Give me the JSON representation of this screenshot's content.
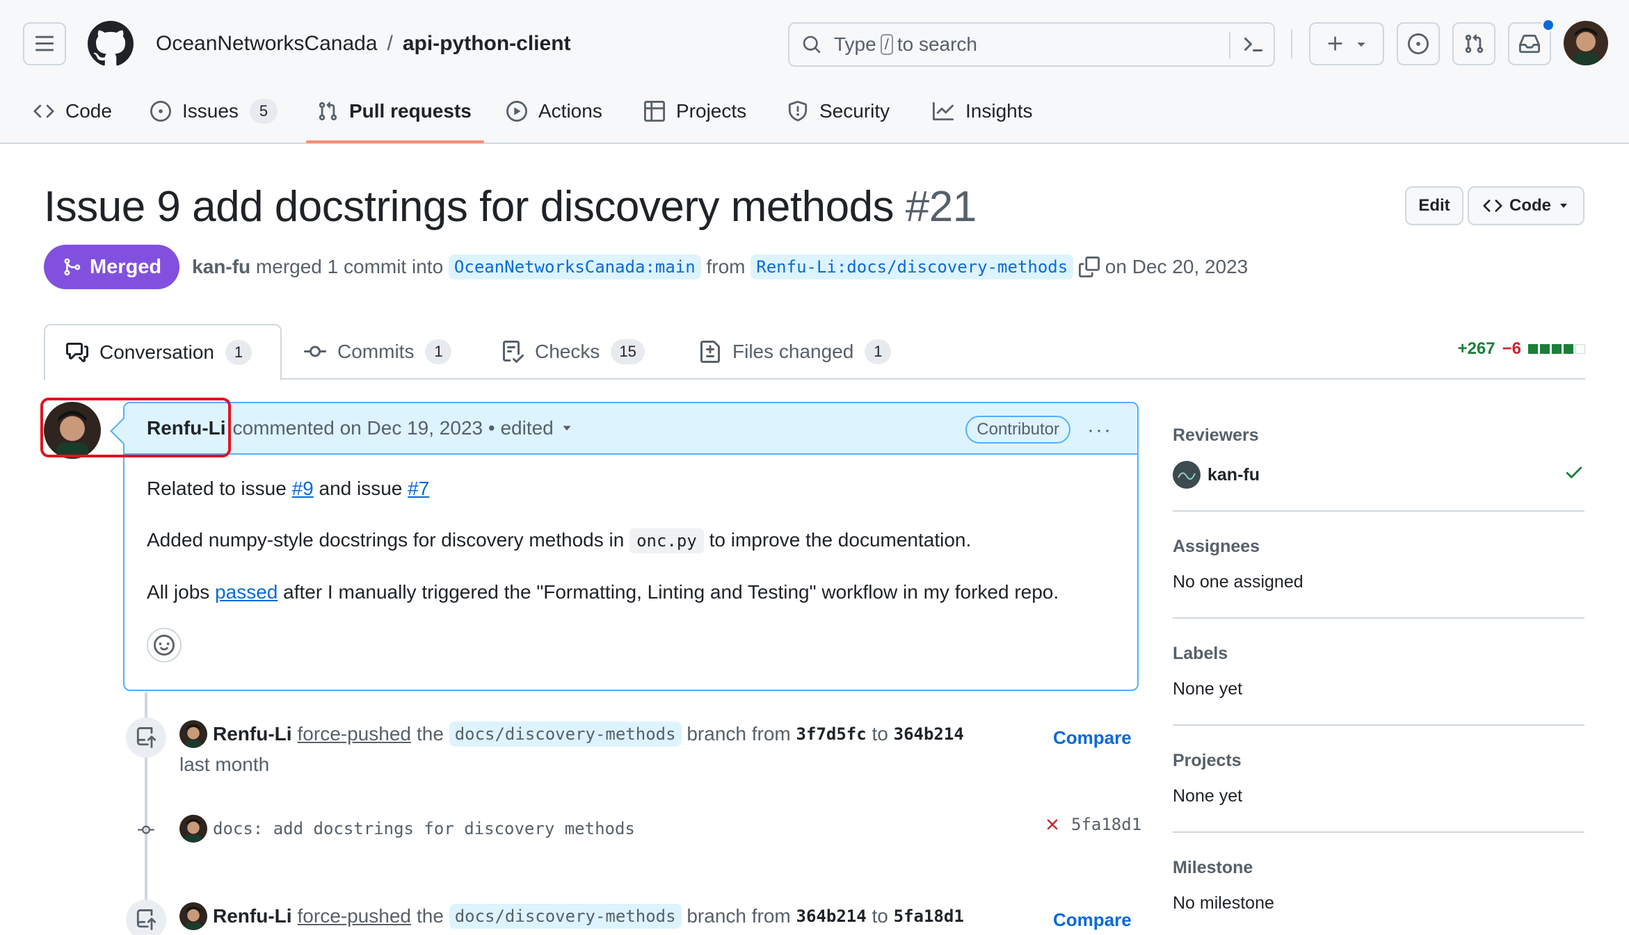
{
  "header": {
    "owner": "OceanNetworksCanada",
    "separator": "/",
    "repo": "api-python-client",
    "search": {
      "prefix": "Type",
      "slash": "/",
      "suffix": "to search"
    }
  },
  "repo_nav": [
    {
      "label": "Code"
    },
    {
      "label": "Issues",
      "count": "5"
    },
    {
      "label": "Pull requests"
    },
    {
      "label": "Actions"
    },
    {
      "label": "Projects"
    },
    {
      "label": "Security"
    },
    {
      "label": "Insights"
    }
  ],
  "pr": {
    "title": "Issue 9 add docstrings for discovery methods",
    "number": "#21",
    "edit_label": "Edit",
    "code_label": "Code",
    "status": "Merged",
    "merger": "kan-fu",
    "merged_text": "merged 1 commit into",
    "base_branch": "OceanNetworksCanada:main",
    "from_text": "from",
    "head_branch": "Renfu-Li:docs/discovery-methods",
    "date_text": "on Dec 20, 2023"
  },
  "tabs": [
    {
      "label": "Conversation",
      "count": "1"
    },
    {
      "label": "Commits",
      "count": "1"
    },
    {
      "label": "Checks",
      "count": "15"
    },
    {
      "label": "Files changed",
      "count": "1"
    }
  ],
  "diffstat": {
    "additions": "+267",
    "deletions": "−6"
  },
  "comment": {
    "author": "Renfu-Li",
    "meta": "commented on Dec 19, 2023 • edited",
    "badge": "Contributor",
    "more": "···",
    "line1": {
      "pre": "Related to issue",
      "link1": "#9",
      "mid": "and issue",
      "link2": "#7"
    },
    "line2": {
      "pre": "Added numpy-style docstrings for discovery methods in",
      "code": "onc.py",
      "post": "to improve the documentation."
    },
    "line3": {
      "pre": "All jobs",
      "link": "passed",
      "post": "after I manually triggered the \"Formatting, Linting and Testing\" workflow in my forked repo."
    }
  },
  "timeline": [
    {
      "author": "Renfu-Li",
      "action": "force-pushed",
      "the": "the",
      "branch": "docs/discovery-methods",
      "from_text": "branch from",
      "from_sha": "3f7d5fc",
      "to": "to",
      "to_sha": "364b214",
      "time": "last month",
      "compare": "Compare"
    },
    {
      "commit_message": "docs: add docstrings for discovery methods",
      "sha": "5fa18d1"
    },
    {
      "author": "Renfu-Li",
      "action": "force-pushed",
      "the": "the",
      "branch": "docs/discovery-methods",
      "from_text": "branch from",
      "from_sha": "364b214",
      "to": "to",
      "to_sha": "5fa18d1",
      "compare": "Compare"
    }
  ],
  "sidebar": {
    "reviewers": {
      "heading": "Reviewers",
      "name": "kan-fu"
    },
    "assignees": {
      "heading": "Assignees",
      "value": "No one assigned"
    },
    "labels": {
      "heading": "Labels",
      "value": "None yet"
    },
    "projects": {
      "heading": "Projects",
      "value": "None yet"
    },
    "milestone": {
      "heading": "Milestone",
      "value": "No milestone"
    }
  },
  "colors": {
    "merged": "#8250df",
    "link": "#0969da",
    "additions": "#1a7f37",
    "deletions": "#cf222e",
    "highlight": "#e0141e",
    "tab_underline": "#fd8c73"
  }
}
